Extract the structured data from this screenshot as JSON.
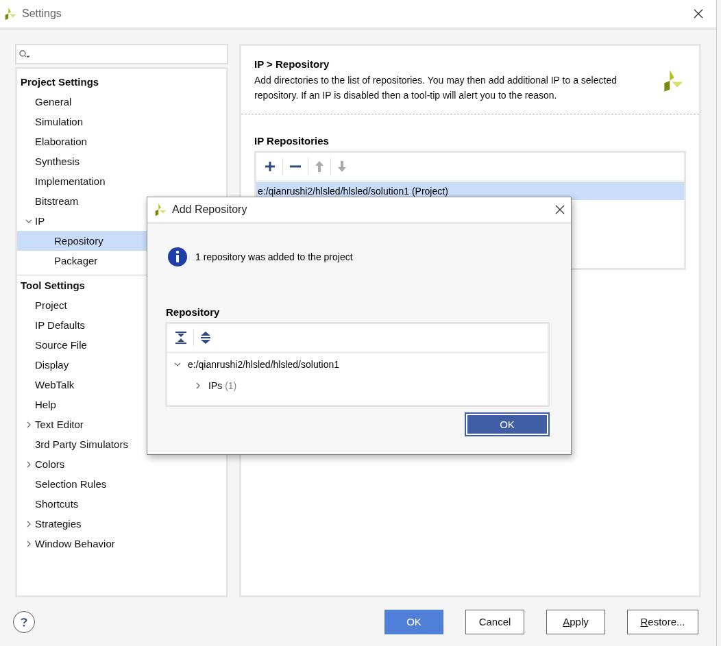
{
  "window": {
    "title": "Settings"
  },
  "sidebar": {
    "sections": [
      {
        "title": "Project Settings",
        "items": [
          {
            "label": "General",
            "selected": false
          },
          {
            "label": "Simulation",
            "selected": false
          },
          {
            "label": "Elaboration",
            "selected": false
          },
          {
            "label": "Synthesis",
            "selected": false
          },
          {
            "label": "Implementation",
            "selected": false
          },
          {
            "label": "Bitstream",
            "selected": false
          },
          {
            "label": "IP",
            "selected": false,
            "expanded": true,
            "children": [
              {
                "label": "Repository",
                "selected": true
              },
              {
                "label": "Packager",
                "selected": false
              }
            ]
          }
        ]
      },
      {
        "title": "Tool Settings",
        "items": [
          {
            "label": "Project",
            "selected": false
          },
          {
            "label": "IP Defaults",
            "selected": false
          },
          {
            "label": "Source File",
            "selected": false
          },
          {
            "label": "Display",
            "selected": false
          },
          {
            "label": "WebTalk",
            "selected": false
          },
          {
            "label": "Help",
            "selected": false
          },
          {
            "label": "Text Editor",
            "selected": false,
            "expanded": false
          },
          {
            "label": "3rd Party Simulators",
            "selected": false
          },
          {
            "label": "Colors",
            "selected": false,
            "expanded": false
          },
          {
            "label": "Selection Rules",
            "selected": false
          },
          {
            "label": "Shortcuts",
            "selected": false
          },
          {
            "label": "Strategies",
            "selected": false,
            "expanded": false
          },
          {
            "label": "Window Behavior",
            "selected": false,
            "expanded": false
          }
        ]
      }
    ]
  },
  "content": {
    "heading": "IP > Repository",
    "description": "Add directories to the list of repositories. You may then add additional IP to a selected repository. If an IP is disabled then a tool-tip will alert you to the reason.",
    "section_title": "IP Repositories",
    "toolbar": [
      {
        "kind": "add",
        "disabled": false
      },
      {
        "kind": "remove",
        "disabled": false
      },
      {
        "kind": "up",
        "disabled": true
      },
      {
        "kind": "down",
        "disabled": true
      }
    ],
    "repositories": [
      {
        "label": "e:/qianrushi2/hlsled/hlsled/solution1 (Project)",
        "selected": true
      }
    ]
  },
  "dialog": {
    "title": "Add Repository",
    "message": "1 repository was added to the project",
    "section_title": "Repository",
    "toolbar": [
      {
        "kind": "collapse-all"
      },
      {
        "kind": "expand-all"
      }
    ],
    "tree": [
      {
        "label": "e:/qianrushi2/hlsled/hlsled/solution1",
        "expanded": true,
        "children": [
          {
            "label": "IPs",
            "count": "(1)",
            "expanded": false
          }
        ]
      }
    ],
    "button": "OK"
  },
  "buttons": [
    {
      "label": "OK",
      "primary": true,
      "mnemonic": false
    },
    {
      "label": "Cancel",
      "primary": false,
      "mnemonic": false
    },
    {
      "label": "Apply",
      "primary": false,
      "mnemonic": true
    },
    {
      "label": "Restore...",
      "primary": false,
      "mnemonic": true
    }
  ]
}
